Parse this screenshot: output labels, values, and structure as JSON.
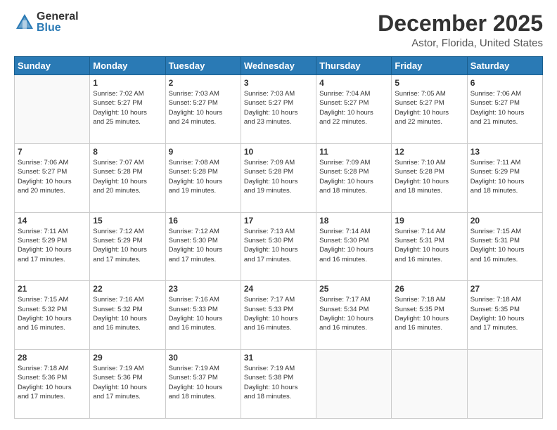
{
  "logo": {
    "general": "General",
    "blue": "Blue"
  },
  "header": {
    "month": "December 2025",
    "location": "Astor, Florida, United States"
  },
  "days_of_week": [
    "Sunday",
    "Monday",
    "Tuesday",
    "Wednesday",
    "Thursday",
    "Friday",
    "Saturday"
  ],
  "weeks": [
    [
      {
        "day": "",
        "info": ""
      },
      {
        "day": "1",
        "info": "Sunrise: 7:02 AM\nSunset: 5:27 PM\nDaylight: 10 hours\nand 25 minutes."
      },
      {
        "day": "2",
        "info": "Sunrise: 7:03 AM\nSunset: 5:27 PM\nDaylight: 10 hours\nand 24 minutes."
      },
      {
        "day": "3",
        "info": "Sunrise: 7:03 AM\nSunset: 5:27 PM\nDaylight: 10 hours\nand 23 minutes."
      },
      {
        "day": "4",
        "info": "Sunrise: 7:04 AM\nSunset: 5:27 PM\nDaylight: 10 hours\nand 22 minutes."
      },
      {
        "day": "5",
        "info": "Sunrise: 7:05 AM\nSunset: 5:27 PM\nDaylight: 10 hours\nand 22 minutes."
      },
      {
        "day": "6",
        "info": "Sunrise: 7:06 AM\nSunset: 5:27 PM\nDaylight: 10 hours\nand 21 minutes."
      }
    ],
    [
      {
        "day": "7",
        "info": "Sunrise: 7:06 AM\nSunset: 5:27 PM\nDaylight: 10 hours\nand 20 minutes."
      },
      {
        "day": "8",
        "info": "Sunrise: 7:07 AM\nSunset: 5:28 PM\nDaylight: 10 hours\nand 20 minutes."
      },
      {
        "day": "9",
        "info": "Sunrise: 7:08 AM\nSunset: 5:28 PM\nDaylight: 10 hours\nand 19 minutes."
      },
      {
        "day": "10",
        "info": "Sunrise: 7:09 AM\nSunset: 5:28 PM\nDaylight: 10 hours\nand 19 minutes."
      },
      {
        "day": "11",
        "info": "Sunrise: 7:09 AM\nSunset: 5:28 PM\nDaylight: 10 hours\nand 18 minutes."
      },
      {
        "day": "12",
        "info": "Sunrise: 7:10 AM\nSunset: 5:28 PM\nDaylight: 10 hours\nand 18 minutes."
      },
      {
        "day": "13",
        "info": "Sunrise: 7:11 AM\nSunset: 5:29 PM\nDaylight: 10 hours\nand 18 minutes."
      }
    ],
    [
      {
        "day": "14",
        "info": "Sunrise: 7:11 AM\nSunset: 5:29 PM\nDaylight: 10 hours\nand 17 minutes."
      },
      {
        "day": "15",
        "info": "Sunrise: 7:12 AM\nSunset: 5:29 PM\nDaylight: 10 hours\nand 17 minutes."
      },
      {
        "day": "16",
        "info": "Sunrise: 7:12 AM\nSunset: 5:30 PM\nDaylight: 10 hours\nand 17 minutes."
      },
      {
        "day": "17",
        "info": "Sunrise: 7:13 AM\nSunset: 5:30 PM\nDaylight: 10 hours\nand 17 minutes."
      },
      {
        "day": "18",
        "info": "Sunrise: 7:14 AM\nSunset: 5:30 PM\nDaylight: 10 hours\nand 16 minutes."
      },
      {
        "day": "19",
        "info": "Sunrise: 7:14 AM\nSunset: 5:31 PM\nDaylight: 10 hours\nand 16 minutes."
      },
      {
        "day": "20",
        "info": "Sunrise: 7:15 AM\nSunset: 5:31 PM\nDaylight: 10 hours\nand 16 minutes."
      }
    ],
    [
      {
        "day": "21",
        "info": "Sunrise: 7:15 AM\nSunset: 5:32 PM\nDaylight: 10 hours\nand 16 minutes."
      },
      {
        "day": "22",
        "info": "Sunrise: 7:16 AM\nSunset: 5:32 PM\nDaylight: 10 hours\nand 16 minutes."
      },
      {
        "day": "23",
        "info": "Sunrise: 7:16 AM\nSunset: 5:33 PM\nDaylight: 10 hours\nand 16 minutes."
      },
      {
        "day": "24",
        "info": "Sunrise: 7:17 AM\nSunset: 5:33 PM\nDaylight: 10 hours\nand 16 minutes."
      },
      {
        "day": "25",
        "info": "Sunrise: 7:17 AM\nSunset: 5:34 PM\nDaylight: 10 hours\nand 16 minutes."
      },
      {
        "day": "26",
        "info": "Sunrise: 7:18 AM\nSunset: 5:35 PM\nDaylight: 10 hours\nand 16 minutes."
      },
      {
        "day": "27",
        "info": "Sunrise: 7:18 AM\nSunset: 5:35 PM\nDaylight: 10 hours\nand 17 minutes."
      }
    ],
    [
      {
        "day": "28",
        "info": "Sunrise: 7:18 AM\nSunset: 5:36 PM\nDaylight: 10 hours\nand 17 minutes."
      },
      {
        "day": "29",
        "info": "Sunrise: 7:19 AM\nSunset: 5:36 PM\nDaylight: 10 hours\nand 17 minutes."
      },
      {
        "day": "30",
        "info": "Sunrise: 7:19 AM\nSunset: 5:37 PM\nDaylight: 10 hours\nand 18 minutes."
      },
      {
        "day": "31",
        "info": "Sunrise: 7:19 AM\nSunset: 5:38 PM\nDaylight: 10 hours\nand 18 minutes."
      },
      {
        "day": "",
        "info": ""
      },
      {
        "day": "",
        "info": ""
      },
      {
        "day": "",
        "info": ""
      }
    ]
  ]
}
